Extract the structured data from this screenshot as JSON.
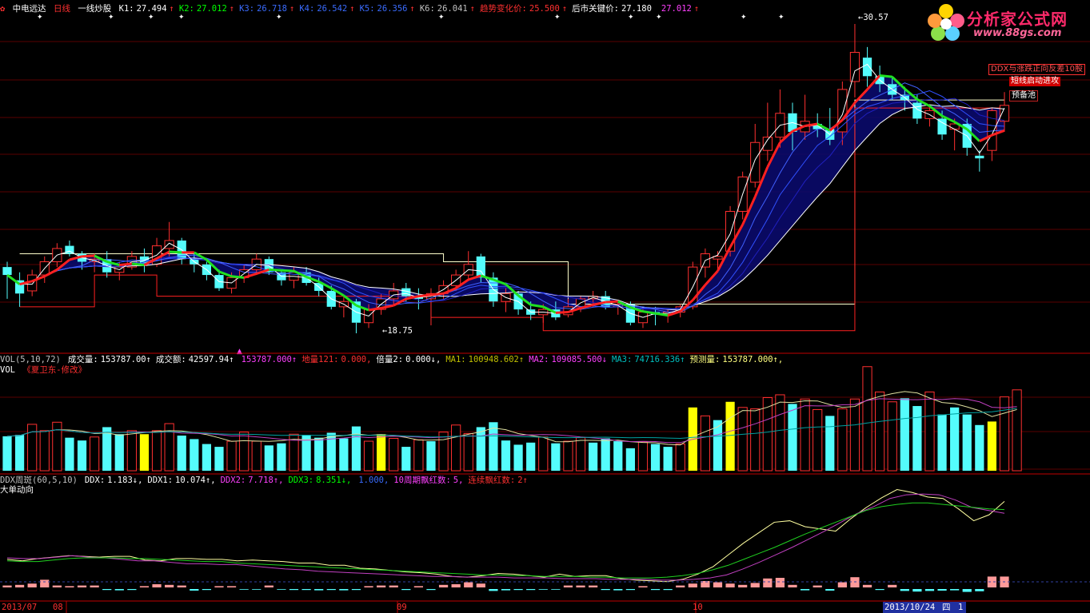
{
  "header": {
    "icon": "chart-icon",
    "stock_name": "中电远达",
    "period": "日线",
    "formula_name": "一线炒股",
    "indicators": [
      {
        "label": "K1:",
        "value": "27.494",
        "arrow": "↑",
        "color": "#ffffff"
      },
      {
        "label": "K2:",
        "value": "27.012",
        "arrow": "↑",
        "color": "#00ff00"
      },
      {
        "label": "K3:",
        "value": "26.718",
        "arrow": "↑",
        "color": "#3a6cff"
      },
      {
        "label": "K4:",
        "value": "26.542",
        "arrow": "↑",
        "color": "#3a6cff"
      },
      {
        "label": "K5:",
        "value": "26.356",
        "arrow": "↑",
        "color": "#3a6cff"
      },
      {
        "label": "K6:",
        "value": "26.041",
        "arrow": "↑",
        "color": "#c0c0c0"
      },
      {
        "label": "趋势变化价:",
        "value": "25.500",
        "arrow": "↑",
        "color": "#ff3030"
      },
      {
        "label": "后市关键价:",
        "value": "27.180",
        "arrow": "",
        "color": "#ffffff"
      },
      {
        "label": "",
        "value": "27.012",
        "arrow": "↑",
        "color": "#ff40ff"
      }
    ]
  },
  "price_panel": {
    "high_label": "30.57",
    "low_label": "18.75",
    "signal_tags": [
      "DDX与涨跌正向反差10股",
      "短线启动进攻",
      "预备池"
    ]
  },
  "volume_panel": {
    "title_line": [
      {
        "label": "VOL(5,10,72)",
        "value": "",
        "color": "#c0c0c0"
      },
      {
        "label": "成交量:",
        "value": "153787.00↑",
        "color": "#ffffff"
      },
      {
        "label": "成交额:",
        "value": "42597.94↑",
        "color": "#ffffff"
      },
      {
        "label": "",
        "value": "153787.000↑",
        "color": "#ff40ff"
      },
      {
        "label": "地量121:",
        "value": "0.000,",
        "color": "#ff3030"
      },
      {
        "label": "倍量2:",
        "value": "0.000↓,",
        "color": "#ffffff"
      },
      {
        "label": "MA1:",
        "value": "100948.602↑",
        "color": "#c0c000"
      },
      {
        "label": "MA2:",
        "value": "109085.500↓",
        "color": "#ff40ff"
      },
      {
        "label": "MA3:",
        "value": "74716.336↑",
        "color": "#00c0c0"
      },
      {
        "label": "预测量:",
        "value": "153787.000↑,",
        "color": "#ffff80"
      }
    ],
    "subtitle": "VOL",
    "author": "《夏卫东-修改》"
  },
  "ddx_panel": {
    "title_line": [
      {
        "label": "DDX周斑(60,5,10)",
        "value": "",
        "color": "#c0c0c0"
      },
      {
        "label": "DDX:",
        "value": "1.183↓,",
        "color": "#ffffff"
      },
      {
        "label": "DDX1:",
        "value": "10.074↑,",
        "color": "#ffffff"
      },
      {
        "label": "DDX2:",
        "value": "7.718↑,",
        "color": "#ff40ff"
      },
      {
        "label": "DDX3:",
        "value": "8.351↓,",
        "color": "#00ff00"
      },
      {
        "label": "",
        "value": "1.000,",
        "color": "#3a6cff"
      },
      {
        "label": "10周期飘红数:",
        "value": "5,",
        "color": "#ff40ff"
      },
      {
        "label": "连续飘红数:",
        "value": "2↑",
        "color": "#ff3030"
      }
    ],
    "subtitle": "大单动向"
  },
  "date_axis": {
    "labels": [
      {
        "text": "2013/07",
        "color": "#ff3030"
      },
      {
        "text": "08",
        "color": "#ff3030"
      },
      {
        "text": "09",
        "color": "#ff3030"
      },
      {
        "text": "10",
        "color": "#ff3030"
      },
      {
        "text": "2013/10/24",
        "color": "#ffffff"
      },
      {
        "text": "四",
        "color": "#ffffff"
      },
      {
        "text": "1",
        "color": "#ffffff"
      }
    ]
  },
  "logo": {
    "title": "分析家公式网",
    "url": "www.88gs.com"
  },
  "colors": {
    "up": "#ff3030",
    "down": "#54fcfc",
    "k1_line": "#ffffff",
    "k2_line": "#00ff00",
    "trend_line": "#ff2020",
    "volume_highlight": "#ffff00",
    "ddx_positive": "#ff9a9a",
    "ddx_negative": "#54fcfc"
  },
  "chart_data": {
    "type": "candlestick",
    "price_range": [
      18.75,
      30.57
    ],
    "candles": [
      {
        "o": 21.4,
        "h": 21.6,
        "l": 20.2,
        "c": 21.1
      },
      {
        "o": 20.9,
        "h": 21.2,
        "l": 19.9,
        "c": 20.4
      },
      {
        "o": 20.5,
        "h": 21.3,
        "l": 20.3,
        "c": 21.1
      },
      {
        "o": 21.1,
        "h": 21.8,
        "l": 20.8,
        "c": 21.6
      },
      {
        "o": 21.6,
        "h": 22.3,
        "l": 21.4,
        "c": 22.1
      },
      {
        "o": 22.2,
        "h": 22.4,
        "l": 21.8,
        "c": 21.9
      },
      {
        "o": 21.9,
        "h": 22.0,
        "l": 21.3,
        "c": 21.6
      },
      {
        "o": 21.6,
        "h": 21.9,
        "l": 21.2,
        "c": 21.7
      },
      {
        "o": 21.7,
        "h": 22.0,
        "l": 21.0,
        "c": 21.2
      },
      {
        "o": 21.2,
        "h": 21.6,
        "l": 20.9,
        "c": 21.4
      },
      {
        "o": 21.4,
        "h": 22.0,
        "l": 21.3,
        "c": 21.8
      },
      {
        "o": 21.8,
        "h": 22.1,
        "l": 21.2,
        "c": 21.5
      },
      {
        "o": 21.5,
        "h": 22.5,
        "l": 21.4,
        "c": 22.2
      },
      {
        "o": 22.1,
        "h": 23.1,
        "l": 21.8,
        "c": 22.4
      },
      {
        "o": 22.4,
        "h": 22.5,
        "l": 21.5,
        "c": 21.7
      },
      {
        "o": 21.7,
        "h": 21.9,
        "l": 21.2,
        "c": 21.5
      },
      {
        "o": 21.5,
        "h": 21.6,
        "l": 20.9,
        "c": 21.1
      },
      {
        "o": 21.1,
        "h": 21.3,
        "l": 20.5,
        "c": 20.6
      },
      {
        "o": 20.6,
        "h": 21.2,
        "l": 20.4,
        "c": 21.0
      },
      {
        "o": 21.0,
        "h": 21.5,
        "l": 20.8,
        "c": 21.3
      },
      {
        "o": 21.3,
        "h": 21.9,
        "l": 21.1,
        "c": 21.7
      },
      {
        "o": 21.7,
        "h": 21.8,
        "l": 21.1,
        "c": 21.2
      },
      {
        "o": 21.2,
        "h": 21.3,
        "l": 20.7,
        "c": 20.9
      },
      {
        "o": 20.9,
        "h": 21.4,
        "l": 20.6,
        "c": 21.2
      },
      {
        "o": 21.2,
        "h": 21.4,
        "l": 20.7,
        "c": 20.8
      },
      {
        "o": 20.8,
        "h": 21.0,
        "l": 20.3,
        "c": 20.5
      },
      {
        "o": 20.5,
        "h": 20.7,
        "l": 19.8,
        "c": 19.9
      },
      {
        "o": 19.9,
        "h": 20.3,
        "l": 19.5,
        "c": 20.1
      },
      {
        "o": 20.1,
        "h": 20.2,
        "l": 18.9,
        "c": 19.3
      },
      {
        "o": 19.3,
        "h": 20.0,
        "l": 19.1,
        "c": 19.8
      },
      {
        "o": 19.8,
        "h": 20.4,
        "l": 19.6,
        "c": 20.2
      },
      {
        "o": 20.2,
        "h": 20.8,
        "l": 20.0,
        "c": 20.5
      },
      {
        "o": 20.6,
        "h": 20.8,
        "l": 20.1,
        "c": 20.3
      },
      {
        "o": 20.3,
        "h": 20.6,
        "l": 19.8,
        "c": 20.2
      },
      {
        "o": 20.2,
        "h": 20.6,
        "l": 19.2,
        "c": 20.4
      },
      {
        "o": 20.4,
        "h": 20.9,
        "l": 20.2,
        "c": 20.7
      },
      {
        "o": 20.7,
        "h": 21.3,
        "l": 20.5,
        "c": 21.1
      },
      {
        "o": 21.1,
        "h": 22.0,
        "l": 20.9,
        "c": 21.5
      },
      {
        "o": 21.8,
        "h": 21.9,
        "l": 20.8,
        "c": 21.0
      },
      {
        "o": 21.0,
        "h": 21.2,
        "l": 19.9,
        "c": 20.1
      },
      {
        "o": 20.1,
        "h": 20.6,
        "l": 19.7,
        "c": 20.4
      },
      {
        "o": 20.4,
        "h": 20.5,
        "l": 19.6,
        "c": 19.8
      },
      {
        "o": 19.8,
        "h": 20.1,
        "l": 19.4,
        "c": 19.6
      },
      {
        "o": 19.6,
        "h": 20.0,
        "l": 19.3,
        "c": 19.8
      },
      {
        "o": 19.8,
        "h": 20.1,
        "l": 19.4,
        "c": 19.5
      },
      {
        "o": 19.6,
        "h": 20.2,
        "l": 19.5,
        "c": 19.9
      },
      {
        "o": 19.9,
        "h": 20.3,
        "l": 19.7,
        "c": 20.2
      },
      {
        "o": 20.2,
        "h": 20.5,
        "l": 19.9,
        "c": 20.3
      },
      {
        "o": 20.3,
        "h": 20.5,
        "l": 19.8,
        "c": 19.9
      },
      {
        "o": 19.9,
        "h": 20.1,
        "l": 19.6,
        "c": 20.0
      },
      {
        "o": 20.0,
        "h": 20.1,
        "l": 19.2,
        "c": 19.3
      },
      {
        "o": 19.3,
        "h": 19.9,
        "l": 19.1,
        "c": 19.7
      },
      {
        "o": 19.7,
        "h": 19.9,
        "l": 19.2,
        "c": 19.6
      },
      {
        "o": 19.6,
        "h": 19.8,
        "l": 19.3,
        "c": 19.7
      },
      {
        "o": 19.7,
        "h": 20.0,
        "l": 19.5,
        "c": 19.9
      },
      {
        "o": 19.9,
        "h": 21.6,
        "l": 19.8,
        "c": 21.4
      },
      {
        "o": 21.4,
        "h": 22.1,
        "l": 21.0,
        "c": 21.9
      },
      {
        "o": 21.7,
        "h": 22.0,
        "l": 21.3,
        "c": 21.8
      },
      {
        "o": 22.0,
        "h": 23.7,
        "l": 21.8,
        "c": 23.5
      },
      {
        "o": 23.5,
        "h": 25.0,
        "l": 23.2,
        "c": 24.8
      },
      {
        "o": 24.6,
        "h": 26.8,
        "l": 24.4,
        "c": 26.1
      },
      {
        "o": 25.8,
        "h": 27.6,
        "l": 25.4,
        "c": 26.3
      },
      {
        "o": 26.3,
        "h": 28.1,
        "l": 25.9,
        "c": 27.2
      },
      {
        "o": 27.2,
        "h": 27.6,
        "l": 25.8,
        "c": 26.5
      },
      {
        "o": 26.5,
        "h": 27.9,
        "l": 26.2,
        "c": 26.9
      },
      {
        "o": 26.8,
        "h": 27.2,
        "l": 26.3,
        "c": 26.6
      },
      {
        "o": 26.6,
        "h": 27.4,
        "l": 26.0,
        "c": 26.2
      },
      {
        "o": 26.5,
        "h": 28.4,
        "l": 26.0,
        "c": 28.1
      },
      {
        "o": 28.4,
        "h": 30.57,
        "l": 27.8,
        "c": 29.5
      },
      {
        "o": 29.3,
        "h": 29.7,
        "l": 28.2,
        "c": 28.6
      },
      {
        "o": 28.6,
        "h": 29.0,
        "l": 28.0,
        "c": 28.3
      },
      {
        "o": 28.3,
        "h": 28.6,
        "l": 27.7,
        "c": 27.9
      },
      {
        "o": 27.9,
        "h": 28.2,
        "l": 27.3,
        "c": 27.7
      },
      {
        "o": 27.6,
        "h": 27.9,
        "l": 26.8,
        "c": 27.0
      },
      {
        "o": 27.0,
        "h": 27.5,
        "l": 26.7,
        "c": 27.3
      },
      {
        "o": 27.0,
        "h": 27.3,
        "l": 26.2,
        "c": 26.4
      },
      {
        "o": 26.6,
        "h": 27.0,
        "l": 25.8,
        "c": 26.8
      },
      {
        "o": 26.8,
        "h": 27.0,
        "l": 25.6,
        "c": 25.9
      },
      {
        "o": 25.6,
        "h": 25.8,
        "l": 25.0,
        "c": 25.5
      },
      {
        "o": 25.8,
        "h": 27.4,
        "l": 25.4,
        "c": 27.3
      },
      {
        "o": 26.9,
        "h": 28.0,
        "l": 26.5,
        "c": 27.5
      }
    ],
    "volume": [
      {
        "v": 49,
        "up": false
      },
      {
        "v": 51,
        "up": false
      },
      {
        "v": 66,
        "up": true
      },
      {
        "v": 57,
        "up": true
      },
      {
        "v": 69,
        "up": true
      },
      {
        "v": 47,
        "up": false
      },
      {
        "v": 43,
        "up": false
      },
      {
        "v": 48,
        "up": true
      },
      {
        "v": 62,
        "up": false
      },
      {
        "v": 52,
        "up": false
      },
      {
        "v": 57,
        "up": true
      },
      {
        "v": 52,
        "up": false
      },
      {
        "v": 57,
        "up": true
      },
      {
        "v": 67,
        "up": true
      },
      {
        "v": 50,
        "up": false
      },
      {
        "v": 45,
        "up": false
      },
      {
        "v": 38,
        "up": false
      },
      {
        "v": 34,
        "up": false
      },
      {
        "v": 42,
        "up": true
      },
      {
        "v": 55,
        "up": true
      },
      {
        "v": 42,
        "up": true
      },
      {
        "v": 36,
        "up": false
      },
      {
        "v": 39,
        "up": false
      },
      {
        "v": 52,
        "up": true
      },
      {
        "v": 51,
        "up": false
      },
      {
        "v": 47,
        "up": false
      },
      {
        "v": 54,
        "up": false
      },
      {
        "v": 46,
        "up": false
      },
      {
        "v": 63,
        "up": false
      },
      {
        "v": 42,
        "up": true
      },
      {
        "v": 52,
        "up": true
      },
      {
        "v": 46,
        "up": true
      },
      {
        "v": 34,
        "up": false
      },
      {
        "v": 44,
        "up": true
      },
      {
        "v": 42,
        "up": false
      },
      {
        "v": 55,
        "up": true
      },
      {
        "v": 65,
        "up": true
      },
      {
        "v": 53,
        "up": true
      },
      {
        "v": 62,
        "up": false
      },
      {
        "v": 69,
        "up": false
      },
      {
        "v": 43,
        "up": false
      },
      {
        "v": 37,
        "up": false
      },
      {
        "v": 40,
        "up": false
      },
      {
        "v": 48,
        "up": true
      },
      {
        "v": 39,
        "up": false
      },
      {
        "v": 42,
        "up": true
      },
      {
        "v": 47,
        "up": true
      },
      {
        "v": 40,
        "up": false
      },
      {
        "v": 46,
        "up": false
      },
      {
        "v": 42,
        "up": false
      },
      {
        "v": 32,
        "up": false
      },
      {
        "v": 41,
        "up": true
      },
      {
        "v": 38,
        "up": false
      },
      {
        "v": 34,
        "up": false
      },
      {
        "v": 38,
        "up": true
      },
      {
        "v": 90,
        "up": true
      },
      {
        "v": 78,
        "up": true
      },
      {
        "v": 72,
        "up": false
      },
      {
        "v": 98,
        "up": true
      },
      {
        "v": 90,
        "up": true
      },
      {
        "v": 88,
        "up": true
      },
      {
        "v": 104,
        "up": true
      },
      {
        "v": 108,
        "up": true
      },
      {
        "v": 95,
        "up": false
      },
      {
        "v": 102,
        "up": true
      },
      {
        "v": 87,
        "up": true
      },
      {
        "v": 78,
        "up": false
      },
      {
        "v": 88,
        "up": true
      },
      {
        "v": 102,
        "up": true
      },
      {
        "v": 148,
        "up": true
      },
      {
        "v": 112,
        "up": true
      },
      {
        "v": 98,
        "up": true
      },
      {
        "v": 103,
        "up": false
      },
      {
        "v": 92,
        "up": false
      },
      {
        "v": 112,
        "up": true
      },
      {
        "v": 80,
        "up": false
      },
      {
        "v": 90,
        "up": false
      },
      {
        "v": 80,
        "up": false
      },
      {
        "v": 65,
        "up": false
      },
      {
        "v": 70,
        "up": false
      },
      {
        "v": 105,
        "up": true
      },
      {
        "v": 115,
        "up": true
      }
    ],
    "volume_highlight_idx": [
      11,
      30,
      55,
      58,
      79
    ],
    "ddx_bars": [
      0.3,
      0.4,
      0.6,
      1.2,
      0.3,
      0.2,
      0.3,
      0.3,
      -0.3,
      -0.4,
      -0.3,
      0.2,
      0.5,
      0.4,
      0.3,
      -0.5,
      -0.3,
      0.2,
      0.2,
      -0.2,
      -0.2,
      0.3,
      -0.2,
      -0.3,
      -0.3,
      -0.4,
      -0.3,
      -0.4,
      -0.3,
      0.2,
      0.3,
      0.3,
      -0.3,
      0.2,
      -0.3,
      0.4,
      0.5,
      0.8,
      0.6,
      -0.6,
      -0.4,
      -0.3,
      -0.3,
      -0.2,
      -0.2,
      0.3,
      0.3,
      0.3,
      -0.3,
      -0.4,
      -0.3,
      0.2,
      -0.3,
      -0.3,
      0.3,
      0.6,
      1.0,
      0.8,
      0.6,
      0.4,
      0.7,
      1.4,
      1.5,
      0.4,
      -0.4,
      0.3,
      -0.5,
      0.8,
      1.6,
      0.4,
      -0.3,
      0.4,
      -0.6,
      -0.8,
      -0.6,
      -0.5,
      -0.4,
      -0.9,
      -0.7,
      1.7,
      1.7
    ],
    "ddx_lines": {
      "DDX": [
        30,
        28,
        31,
        33,
        35,
        34,
        33,
        34,
        34,
        29,
        28,
        31,
        31,
        30,
        30,
        28,
        29,
        28,
        27,
        25,
        25,
        22,
        22,
        18,
        17,
        15,
        13,
        12,
        10,
        7,
        6,
        8,
        11,
        10,
        8,
        6,
        10,
        7,
        8,
        8,
        4,
        2,
        1,
        0,
        3,
        10,
        20,
        36,
        52,
        66,
        80,
        82,
        74,
        71,
        68,
        85,
        100,
        113,
        124,
        120,
        114,
        112,
        98,
        82,
        90,
        108
      ],
      "DDX1": [
        32,
        31,
        31,
        33,
        35,
        33,
        32,
        30,
        28,
        28,
        26,
        24,
        24,
        23,
        23,
        21,
        19,
        17,
        16,
        14,
        13,
        12,
        11,
        10,
        9,
        8,
        7,
        7,
        6,
        6,
        6,
        5,
        5,
        5,
        4,
        4,
        4,
        3,
        3,
        3,
        2,
        2,
        3,
        5,
        9,
        17,
        26,
        36,
        46,
        57,
        68,
        80,
        92,
        101,
        112,
        117,
        118,
        117,
        110,
        100,
        96,
        92
      ],
      "DDX2": [
        28,
        27,
        27,
        29,
        31,
        32,
        32,
        32,
        31,
        31,
        30,
        29,
        28,
        27,
        27,
        25,
        24,
        23,
        22,
        21,
        20,
        19,
        18,
        17,
        16,
        15,
        14,
        13,
        12,
        11,
        10,
        9,
        9,
        8,
        8,
        7,
        7,
        7,
        6,
        6,
        5,
        5,
        5,
        6,
        8,
        11,
        16,
        22,
        30,
        38,
        46,
        55,
        64,
        72,
        80,
        88,
        96,
        101,
        104,
        106,
        106,
        104,
        102,
        100,
        98,
        97
      ]
    },
    "ddx_range": [
      -10,
      130
    ]
  }
}
